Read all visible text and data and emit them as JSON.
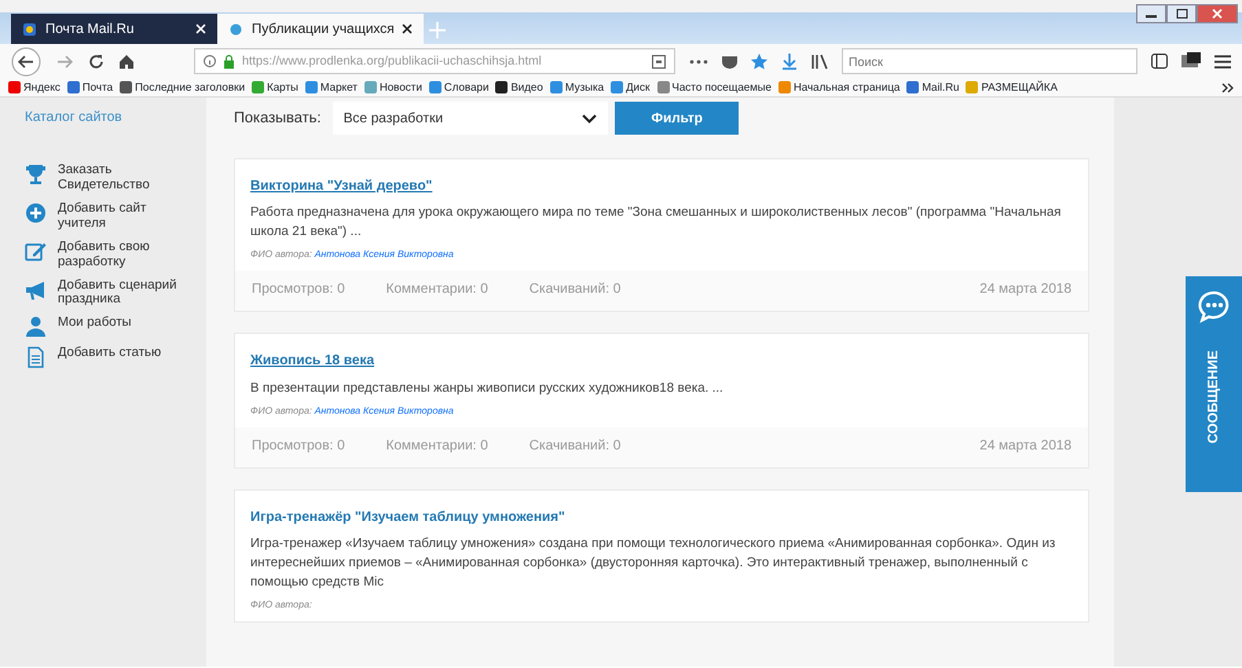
{
  "browser": {
    "tabs": [
      {
        "title": "Почта Mail.Ru",
        "selected": false
      },
      {
        "title": "Публикации учащихся",
        "selected": true
      }
    ],
    "address": "https://www.prodlenka.org/publikacii-uchaschihsja.html",
    "search": {
      "placeholder": "Поиск"
    },
    "bookmarks": [
      "Яндекс",
      "Почта",
      "Последние заголовки",
      "Карты",
      "Маркет",
      "Новости",
      "Словари",
      "Видео",
      "Музыка",
      "Диск",
      "Часто посещаемые",
      "Начальная страница",
      "Mail.Ru",
      "РАЗМЕЩАЙКА"
    ]
  },
  "sidebar": {
    "title": "Каталог сайтов",
    "items": [
      "Заказать Свидетельство",
      "Добавить сайт учителя",
      "Добавить свою разработку",
      "Добавить сценарий праздника",
      "Мои работы",
      "Добавить статью"
    ]
  },
  "filter": {
    "label": "Показывать:",
    "value": "Все разработки",
    "button": "Фильтр"
  },
  "posts": [
    {
      "title": "Викторина \"Узнай дерево\"",
      "underlined": true,
      "text": "Работа предназначена для урока окружающего мира по теме \"Зона смешанных и широколиственных лесов\" (программа \"Начальная школа 21 века\") ...",
      "author_label": "ФИО автора:",
      "author": "Антонова Ксения Викторовна",
      "stats": [
        "Просмотров: 0",
        "Комментарии: 0",
        "Скачиваний: 0"
      ],
      "date": "24 марта 2018"
    },
    {
      "title": "Живопись 18 века",
      "underlined": true,
      "text": "В презентации представлены жанры живописи русских художников18 века. ...",
      "author_label": "ФИО автора:",
      "author": "Антонова Ксения Викторовна",
      "stats": [
        "Просмотров: 0",
        "Комментарии: 0",
        "Скачиваний: 0"
      ],
      "date": "24 марта 2018"
    },
    {
      "title": "Игра-тренажёр \"Изучаем таблицу умножения\"",
      "underlined": false,
      "text": "Игра-тренажер «Изучаем таблицу умножения» создана при помощи технологического приема «Анимированная сорбонка». Один из интереснейших приемов – «Анимированная сорбонка» (двусторонняя карточка). Это интерактивный тренажер, выполненный с помощью средств Mic",
      "author_label": "ФИО автора:"
    }
  ],
  "message_tab": "СООБЩЕНИЕ"
}
